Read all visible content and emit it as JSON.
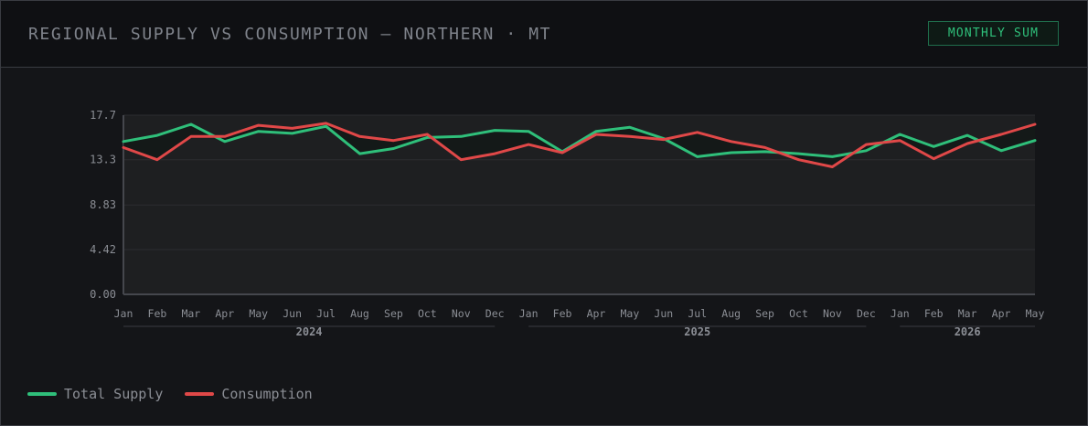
{
  "header": {
    "title": "REGIONAL SUPPLY VS CONSUMPTION — NORTHERN · MT",
    "badge": "MONTHLY SUM"
  },
  "colors": {
    "supply": "#2fbf7a",
    "consumption": "#e04848",
    "gridline": "#2c2d31",
    "plot_bg": "#1e1f21"
  },
  "chart_data": {
    "type": "line",
    "categories": [
      "Jan",
      "Feb",
      "Mar",
      "Apr",
      "May",
      "Jun",
      "Jul",
      "Aug",
      "Sep",
      "Oct",
      "Nov",
      "Dec",
      "Jan",
      "Feb",
      "Apr",
      "May",
      "Jun",
      "Jul",
      "Aug",
      "Sep",
      "Oct",
      "Nov",
      "Dec",
      "Jan",
      "Feb",
      "Mar",
      "Apr",
      "May"
    ],
    "year_groups": [
      {
        "label": "2024",
        "start": 0,
        "end": 11
      },
      {
        "label": "2025",
        "start": 12,
        "end": 22
      },
      {
        "label": "2026",
        "start": 23,
        "end": 27
      }
    ],
    "series": [
      {
        "name": "Total Supply",
        "color": "#2fbf7a",
        "values": [
          15.1,
          15.7,
          16.8,
          15.1,
          16.1,
          15.9,
          16.6,
          13.9,
          14.4,
          15.5,
          15.6,
          16.2,
          16.1,
          14.1,
          16.1,
          16.5,
          15.4,
          13.6,
          14.0,
          14.1,
          13.9,
          13.6,
          14.2,
          15.8,
          14.6,
          15.7,
          14.2,
          15.2
        ]
      },
      {
        "name": "Consumption",
        "color": "#e04848",
        "values": [
          14.5,
          13.3,
          15.6,
          15.6,
          16.7,
          16.4,
          16.9,
          15.6,
          15.2,
          15.8,
          13.3,
          13.9,
          14.8,
          14.0,
          15.8,
          15.6,
          15.3,
          16.0,
          15.1,
          14.5,
          13.3,
          12.6,
          14.8,
          15.2,
          13.4,
          14.9,
          15.8,
          16.8
        ]
      }
    ],
    "yticks": [
      "0.00",
      "4.42",
      "8.83",
      "13.3",
      "17.7"
    ],
    "ytick_values": [
      0,
      4.42,
      8.83,
      13.3,
      17.7
    ],
    "ylim": [
      0,
      17.7
    ],
    "grid": true,
    "legend_position": "bottom-left"
  }
}
